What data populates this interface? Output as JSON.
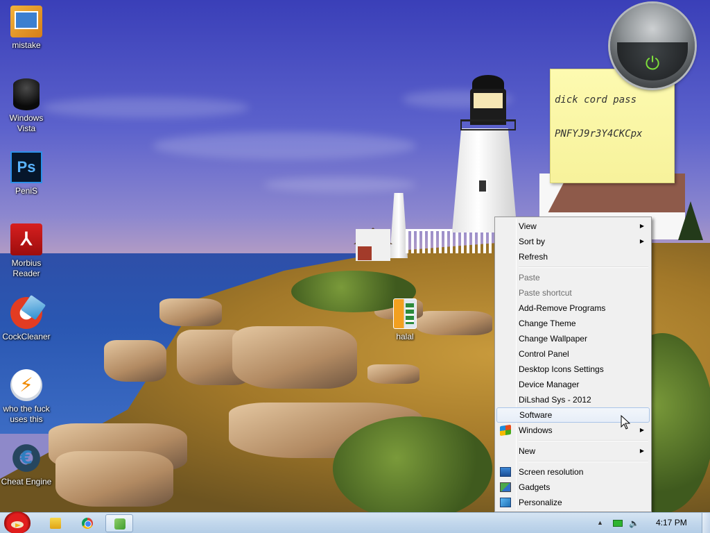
{
  "desktop": {
    "icons": [
      {
        "label": "mistake",
        "icon": "shortcut-folder-icon"
      },
      {
        "label": "Windows Vista",
        "icon": "recycle-bin-icon"
      },
      {
        "label": "PeniS",
        "icon": "photoshop-icon",
        "glyph": "Ps"
      },
      {
        "label": "Morbius Reader",
        "icon": "pdf-reader-icon"
      },
      {
        "label": "CockCleaner",
        "icon": "ccleaner-icon"
      },
      {
        "label": "who the fuck uses this",
        "icon": "lightning-app-icon"
      },
      {
        "label": "Cheat Engine",
        "icon": "cheat-engine-icon"
      },
      {
        "label": "halal",
        "icon": "file-icon"
      }
    ]
  },
  "sticky_note": {
    "line1": "dick cord pass",
    "line2": "PNFYJ9r3Y4CKCpx"
  },
  "power_gadget": {
    "icon": "power-icon",
    "accent": "#7ee03a"
  },
  "context_menu": {
    "items": [
      {
        "label": "View",
        "submenu": true,
        "enabled": true
      },
      {
        "label": "Sort by",
        "submenu": true,
        "enabled": true
      },
      {
        "label": "Refresh",
        "enabled": true
      },
      {
        "label": "Paste",
        "enabled": false
      },
      {
        "label": "Paste shortcut",
        "enabled": false
      },
      {
        "label": "Add-Remove Programs",
        "enabled": true
      },
      {
        "label": "Change Theme",
        "enabled": true
      },
      {
        "label": "Change Wallpaper",
        "enabled": true
      },
      {
        "label": "Control Panel",
        "enabled": true
      },
      {
        "label": "Desktop Icons Settings",
        "enabled": true
      },
      {
        "label": "Device Manager",
        "enabled": true
      },
      {
        "label": "DiLshad Sys - 2012",
        "enabled": true
      },
      {
        "label": "Software",
        "enabled": true,
        "highlighted": true
      },
      {
        "label": "Windows",
        "submenu": true,
        "enabled": true,
        "icon": "windows-logo-icon"
      },
      {
        "label": "New",
        "submenu": true,
        "enabled": true
      },
      {
        "label": "Screen resolution",
        "enabled": true,
        "icon": "screen-resolution-icon"
      },
      {
        "label": "Gadgets",
        "enabled": true,
        "icon": "gadgets-icon"
      },
      {
        "label": "Personalize",
        "enabled": true,
        "icon": "personalize-icon"
      }
    ]
  },
  "taskbar": {
    "start_icon": "angry-bird-start-icon",
    "pinned": [
      {
        "name": "windows-explorer",
        "icon": "folder-icon"
      },
      {
        "name": "google-chrome",
        "icon": "chrome-icon"
      },
      {
        "name": "switcher",
        "icon": "window-switch-icon",
        "active": true
      }
    ],
    "tray": {
      "show_hidden_arrow": "▲",
      "battery_icon": "battery-icon",
      "volume_icon": "volume-icon",
      "volume_glyph": "🔈"
    },
    "clock": "4:17 PM"
  },
  "colors": {
    "taskbar": "#c2d7ec",
    "menu_background": "#f0f0f0",
    "menu_highlight_border": "#a9c4e8",
    "sticky_note": "#fdfab0"
  }
}
